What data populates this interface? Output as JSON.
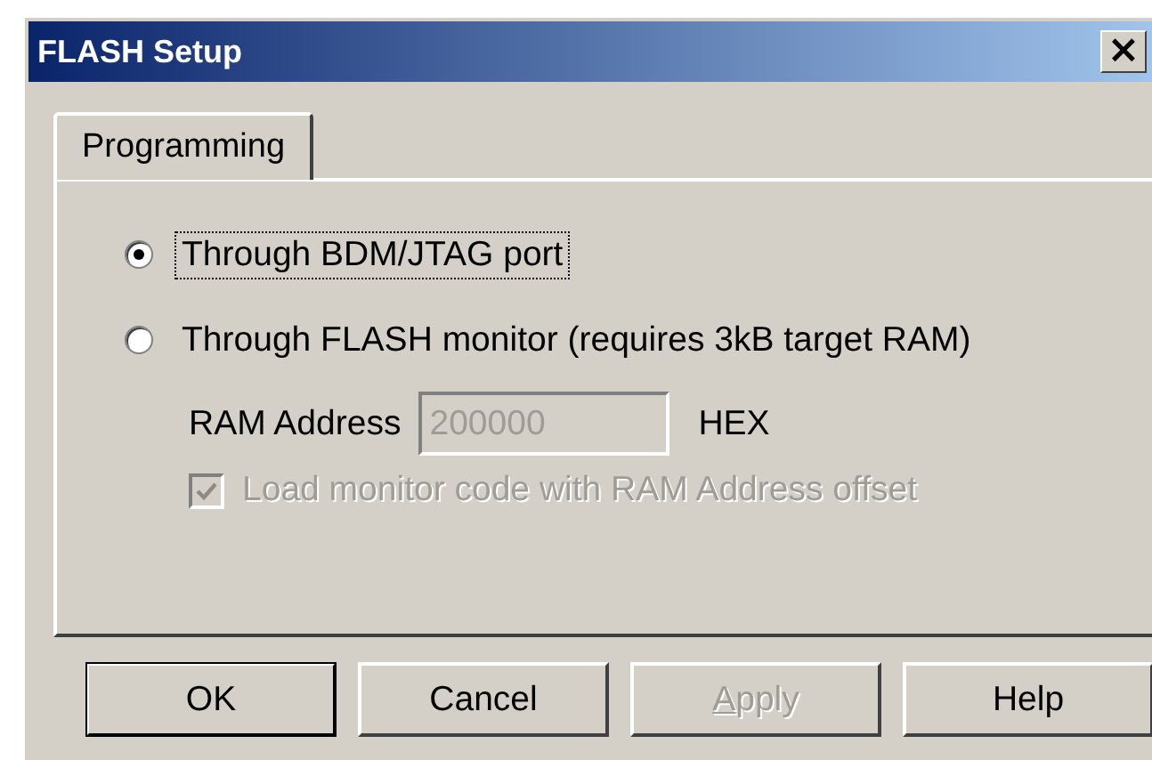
{
  "window": {
    "title": "FLASH Setup",
    "close": "×"
  },
  "tabs": [
    {
      "label": "Programming",
      "selected": true
    }
  ],
  "options": [
    {
      "kind": "radio",
      "label": "Through BDM/JTAG port",
      "selected": true,
      "focused": true
    },
    {
      "kind": "radio",
      "label": "Through FLASH monitor (requires 3kB target RAM)",
      "selected": false,
      "focused": false
    }
  ],
  "ram_address": {
    "label": "RAM Address",
    "value": "200000",
    "unit": "HEX",
    "disabled": true
  },
  "monitor_offset": {
    "label": "Load monitor code with RAM Address offset",
    "checked": true,
    "disabled": true
  },
  "buttons": [
    {
      "label": "OK",
      "default": true,
      "disabled": false
    },
    {
      "label": "Cancel",
      "default": false,
      "disabled": false
    },
    {
      "label": "Apply",
      "default": false,
      "disabled": true
    },
    {
      "label": "Help",
      "default": false,
      "disabled": false
    }
  ]
}
